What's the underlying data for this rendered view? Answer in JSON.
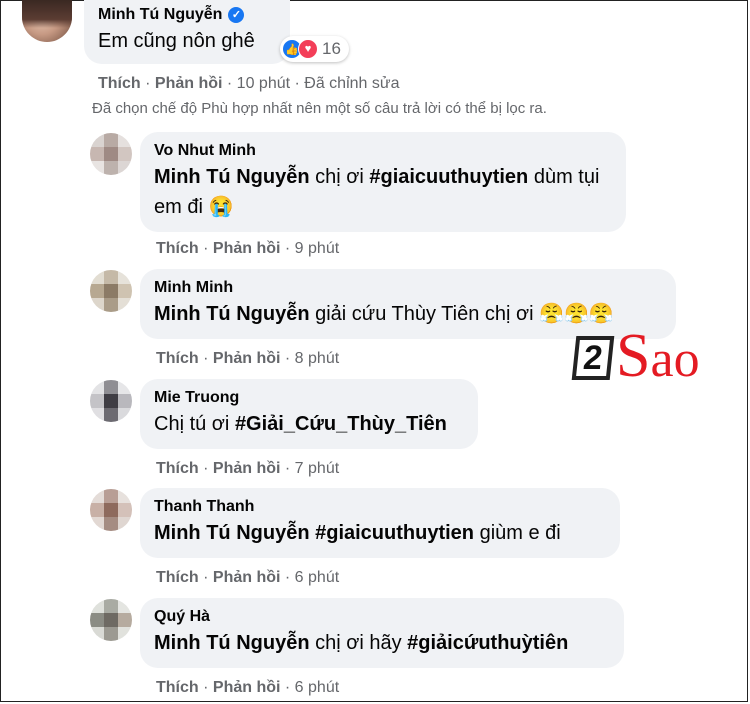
{
  "main_comment": {
    "author": "Minh Tú Nguyễn",
    "verified_icon": "check-icon",
    "text": "Em cũng nôn ghê",
    "reaction_count": "16",
    "like_label": "Thích",
    "reply_label": "Phản hồi",
    "time": "10 phút",
    "edited": "Đã chỉnh sửa"
  },
  "filter_note": "Đã chọn chế độ Phù hợp nhất nên một số câu trả lời có thể bị lọc ra.",
  "replies": [
    {
      "author": "Vo Nhut Minh",
      "mention": "Minh Tú Nguyễn",
      "text_a": "chị ơi",
      "hashtag": "#giaicuuthuytien",
      "text_b": "dùm tụi",
      "line2": "em đi 😭",
      "like": "Thích",
      "reply": "Phản hồi",
      "time": "9 phút"
    },
    {
      "author": "Minh Minh",
      "mention": "Minh Tú Nguyễn",
      "text": "giải cứu Thùy Tiên chị ơi 😤😤😤",
      "like": "Thích",
      "reply": "Phản hồi",
      "time": "8 phút"
    },
    {
      "author": "Mie Truong",
      "text": "Chị tú ơi",
      "hashtag": "#Giải_Cứu_Thùy_Tiên",
      "like": "Thích",
      "reply": "Phản hồi",
      "time": "7 phút"
    },
    {
      "author": "Thanh Thanh",
      "mention": "Minh Tú Nguyễn",
      "hashtag": "#giaicuuthuytien",
      "text": "giùm e đi",
      "like": "Thích",
      "reply": "Phản hồi",
      "time": "6 phút"
    },
    {
      "author": "Quý Hà",
      "mention": "Minh Tú Nguyễn",
      "text": "chị ơi hãy",
      "hashtag": "#giảicứuthuỳtiên",
      "like": "Thích",
      "reply": "Phản hồi",
      "time": "6 phút"
    }
  ],
  "watermark": {
    "box": "2",
    "s": "S",
    "rest": "ao"
  },
  "colors": {
    "link": "#1877f2",
    "meta": "#65676b",
    "bubble": "#f0f2f5",
    "brand": "#e41b23"
  }
}
